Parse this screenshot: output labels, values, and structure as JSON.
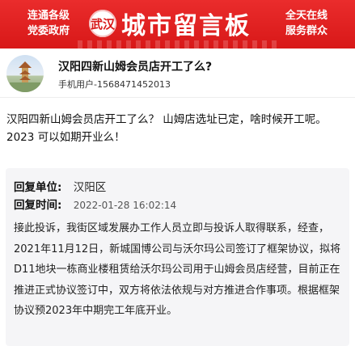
{
  "banner": {
    "left_line1": "连通各级",
    "left_line2": "党委政府",
    "seal_text": "武汉",
    "title": "城市留言板",
    "right_line1": "全天在线",
    "right_line2": "服务群众"
  },
  "post": {
    "title": "汉阳四新山姆会员店开工了么?",
    "user": "手机用户-1568471452013",
    "question": "汉阳四新山姆会员店开工了么？   山姆店选址已定，啥时候开工呢。 2023 可以如期开业么！"
  },
  "reply": {
    "unit_label": "回复单位:",
    "unit_value": "汉阳区",
    "time_label": "回复时间:",
    "time_value": "2022-01-28 16:02:14",
    "body": "接此投诉，我街区域发展办工作人员立即与投诉人取得联系，经查，2021年11月12日，新城国博公司与沃尔玛公司签订了框架协议，拟将D11地块一栋商业楼租赁给沃尔玛公司用于山姆会员店经营，目前正在推进正式协议签订中，双方将依法依规与对方推进合作事项。根据框架协议预2023年中期完工年底开业。"
  }
}
